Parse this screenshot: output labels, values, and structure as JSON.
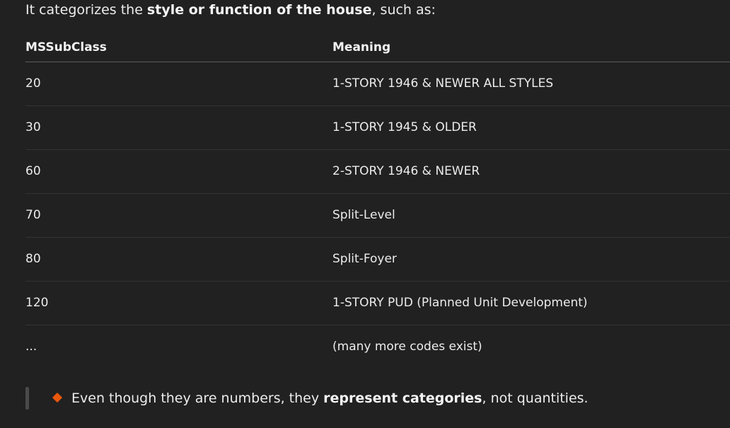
{
  "intro": {
    "prefix": "It categorizes the ",
    "bold": "style or function of the house",
    "suffix": ", such as:"
  },
  "table": {
    "headers": [
      "MSSubClass",
      "Meaning"
    ],
    "rows": [
      [
        "20",
        "1-STORY 1946 & NEWER ALL STYLES"
      ],
      [
        "30",
        "1-STORY 1945 & OLDER"
      ],
      [
        "60",
        "2-STORY 1946 & NEWER"
      ],
      [
        "70",
        "Split-Level"
      ],
      [
        "80",
        "Split-Foyer"
      ],
      [
        "120",
        "1-STORY PUD (Planned Unit Development)"
      ],
      [
        "...",
        "(many more codes exist)"
      ]
    ]
  },
  "note": {
    "icon": "orange-diamond-icon",
    "prefix": "Even though they are numbers, they ",
    "bold": "represent categories",
    "suffix": ", not quantities."
  },
  "colors": {
    "background": "#212121",
    "accent": "#ea580c",
    "text": "#ececec"
  }
}
